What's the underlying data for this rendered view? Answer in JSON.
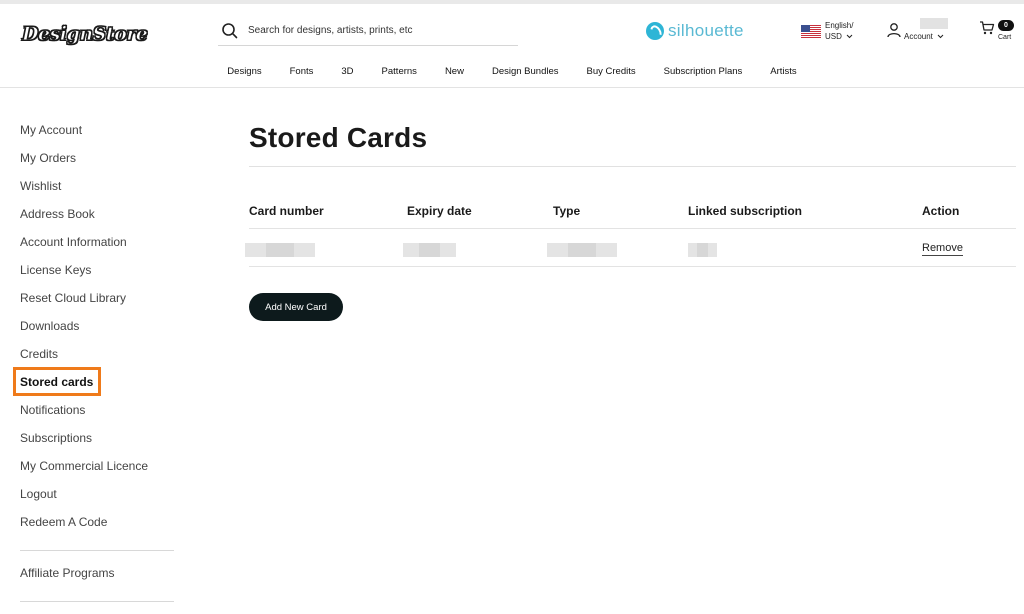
{
  "header": {
    "logo_text": "DesignStore",
    "search_placeholder": "Search for designs, artists, prints, etc",
    "partner_brand": "silhouette",
    "locale_language": "English/",
    "locale_currency": "USD",
    "account_label": "Account",
    "cart_count": "0",
    "cart_label": "Cart"
  },
  "nav": {
    "items": [
      "Designs",
      "Fonts",
      "3D",
      "Patterns",
      "New",
      "Design Bundles",
      "Buy Credits",
      "Subscription Plans",
      "Artists"
    ]
  },
  "sidebar": {
    "items": [
      "My Account",
      "My Orders",
      "Wishlist",
      "Address Book",
      "Account Information",
      "License Keys",
      "Reset Cloud Library",
      "Downloads",
      "Credits",
      "Stored cards",
      "Notifications",
      "Subscriptions",
      "My Commercial Licence",
      "Logout",
      "Redeem A Code"
    ],
    "active_item": "Stored cards",
    "extra_item": "Affiliate Programs"
  },
  "main": {
    "title": "Stored Cards",
    "table": {
      "headers": [
        "Card number",
        "Expiry date",
        "Type",
        "Linked subscription",
        "Action"
      ],
      "rows": [
        {
          "action_label": "Remove"
        }
      ]
    },
    "add_button_label": "Add New Card"
  },
  "colors": {
    "highlight": "#ef7a1a",
    "button_bg": "#0d1a1c",
    "silhouette_brand": "#2eb5d6"
  },
  "icons": [
    "search-icon",
    "flag-us-icon",
    "chevron-down-icon",
    "account-icon",
    "cart-icon",
    "silhouette-logo-icon"
  ]
}
